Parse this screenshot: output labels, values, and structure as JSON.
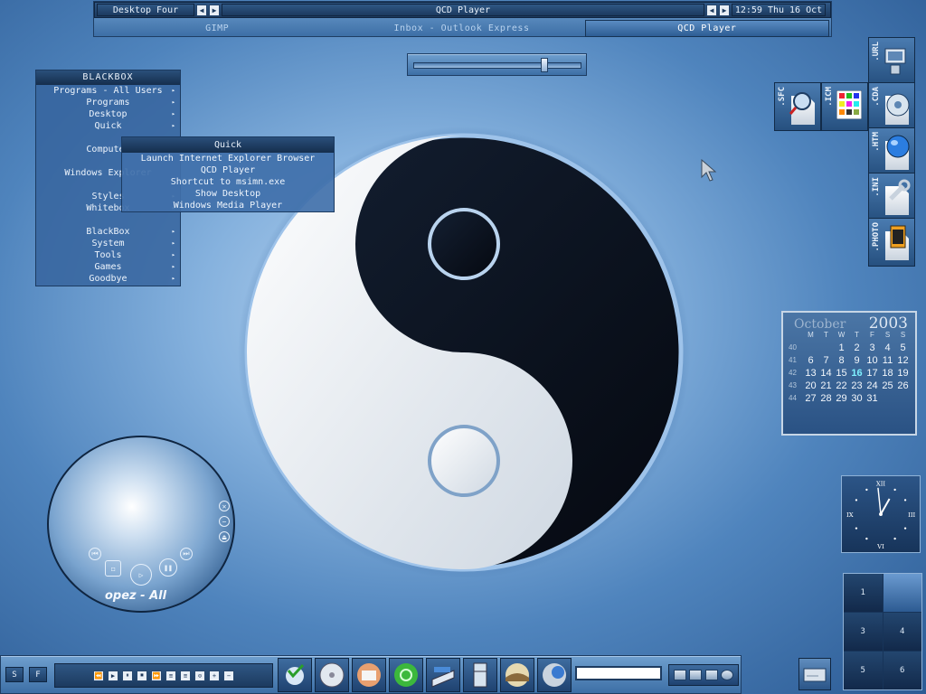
{
  "toolbar": {
    "workspace_name": "Desktop Four",
    "window_title": "QCD Player",
    "clock": "12:59 Thu 16 Oct",
    "tasks": [
      {
        "label": "GIMP"
      },
      {
        "label": "Inbox - Outlook Express"
      },
      {
        "label": "QCD Player"
      }
    ]
  },
  "slider": {
    "position_fraction": 0.78
  },
  "blackbox_menu": {
    "title": "BLACKBOX",
    "items": [
      {
        "label": "Programs - All Users",
        "submenu": true
      },
      {
        "label": "Programs",
        "submenu": true
      },
      {
        "label": "Desktop",
        "submenu": true
      },
      {
        "label": "Quick",
        "submenu": true
      },
      {
        "label": "",
        "separator": true
      },
      {
        "label": "Computer",
        "submenu": true
      },
      {
        "label": "",
        "separator": true
      },
      {
        "label": "Windows Explorer",
        "submenu": false
      },
      {
        "label": "",
        "separator": true
      },
      {
        "label": "Styles",
        "submenu": true
      },
      {
        "label": "Whitebox",
        "submenu": true
      },
      {
        "label": "",
        "separator": true
      },
      {
        "label": "BlackBox",
        "submenu": true
      },
      {
        "label": "System",
        "submenu": true
      },
      {
        "label": "Tools",
        "submenu": true
      },
      {
        "label": "Games",
        "submenu": true
      },
      {
        "label": "Goodbye",
        "submenu": true
      }
    ]
  },
  "quick_submenu": {
    "title": "Quick",
    "items": [
      "Launch Internet Explorer Browser",
      "QCD Player",
      "Shortcut to msimn.exe",
      "Show Desktop",
      "Windows Media Player"
    ]
  },
  "file_type_icons": [
    {
      "label": ".URL",
      "icon": "network-computer-icon"
    },
    {
      "label": ".SFC",
      "icon": "magnifier-icon"
    },
    {
      "label": ".ICM",
      "icon": "color-palette-icon"
    },
    {
      "label": ".CDA",
      "icon": "cd-audio-icon"
    },
    {
      "label": ".HTM",
      "icon": "globe-icon"
    },
    {
      "label": ".INI",
      "icon": "wrench-icon"
    },
    {
      "label": ".PHOTO",
      "icon": "film-icon"
    }
  ],
  "calendar": {
    "month": "October",
    "year": "2003",
    "weekdays": [
      "M",
      "T",
      "W",
      "T",
      "F",
      "S",
      "S"
    ],
    "weeks": [
      {
        "num": "40",
        "days": [
          "",
          "",
          "1",
          "2",
          "3",
          "4",
          "5"
        ]
      },
      {
        "num": "41",
        "days": [
          "6",
          "7",
          "8",
          "9",
          "10",
          "11",
          "12"
        ]
      },
      {
        "num": "42",
        "days": [
          "13",
          "14",
          "15",
          "16",
          "17",
          "18",
          "19"
        ]
      },
      {
        "num": "43",
        "days": [
          "20",
          "21",
          "22",
          "23",
          "24",
          "25",
          "26"
        ]
      },
      {
        "num": "44",
        "days": [
          "27",
          "28",
          "29",
          "30",
          "31",
          "",
          ""
        ]
      }
    ],
    "today": "16"
  },
  "analog_clock": {
    "numerals": {
      "top": "XII",
      "right": "III",
      "bottom": "VI",
      "left": "IX"
    },
    "hour": 12,
    "minute": 59
  },
  "pager": {
    "desktops": [
      {
        "label": "1"
      },
      {
        "label": ""
      },
      {
        "label": "3"
      },
      {
        "label": "4"
      },
      {
        "label": "5"
      },
      {
        "label": "6"
      }
    ],
    "active_index": 1
  },
  "media_player": {
    "label": "opez - All",
    "buttons": [
      "close",
      "minimize",
      "eject",
      "previous",
      "next",
      "stop",
      "play",
      "pause"
    ]
  },
  "bottom_bar": {
    "left_buttons": [
      "S",
      "F"
    ],
    "transport": [
      "⏪",
      "▶",
      "⏸",
      "⏹",
      "⏩",
      "≡",
      "≡",
      "⊙",
      "+",
      "−"
    ],
    "apps": [
      {
        "icon": "checkmark-search-icon"
      },
      {
        "icon": "dvd-disc-icon"
      },
      {
        "icon": "mail-icon"
      },
      {
        "icon": "green-orb-icon"
      },
      {
        "icon": "scanner-icon"
      },
      {
        "icon": "fridge-icon"
      },
      {
        "icon": "landscape-icon"
      },
      {
        "icon": "disc-globe-icon"
      }
    ]
  },
  "colors": {
    "accent": "#2d5d94",
    "today": "#7ef0ff"
  }
}
